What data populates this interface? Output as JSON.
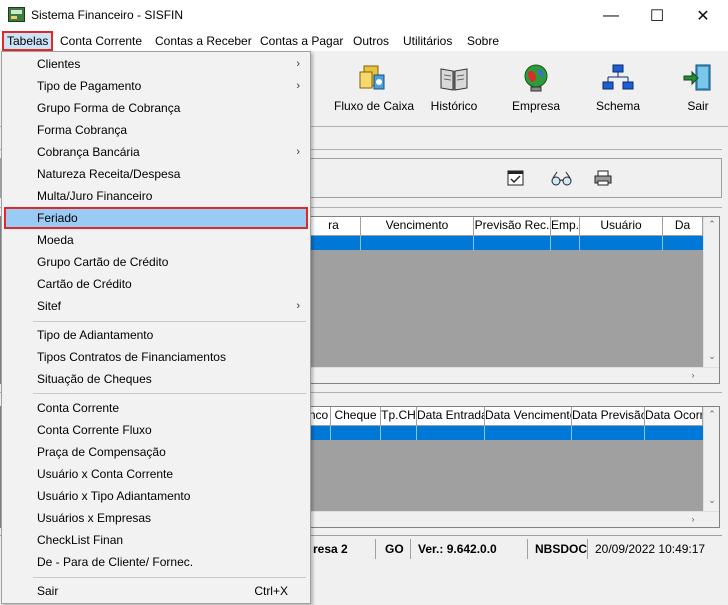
{
  "window": {
    "title": "Sistema Financeiro - SISFIN",
    "min": "—",
    "max": "☐",
    "close": "✕"
  },
  "menubar": [
    {
      "label": "Tabelas"
    },
    {
      "label": "Conta Corrente"
    },
    {
      "label": "Contas a Receber"
    },
    {
      "label": "Contas a Pagar"
    },
    {
      "label": "Outros"
    },
    {
      "label": "Utilitários"
    },
    {
      "label": "Sobre"
    }
  ],
  "toolbar": [
    {
      "label": "Fluxo de Caixa",
      "icon": "cash-flow-icon"
    },
    {
      "label": "Histórico",
      "icon": "book-icon"
    },
    {
      "label": "Empresa",
      "icon": "globe-icon"
    },
    {
      "label": "Schema",
      "icon": "network-icon"
    },
    {
      "label": "Sair",
      "icon": "exit-icon"
    }
  ],
  "grid1": {
    "columns": [
      "ra",
      "Vencimento",
      "Previsão Rec.",
      "Emp.",
      "Usuário",
      "Da"
    ]
  },
  "grid2": {
    "columns": [
      "nco",
      "Cheque",
      "Tp.CH",
      "Data Entrada",
      "Data Vencimento",
      "Data Previsão",
      "Data Ocorrê"
    ]
  },
  "statusbar": {
    "empresa": "resa 2",
    "uf": "GO",
    "version": "Ver.: 9.642.0.0",
    "schema": "NBSDOC",
    "datetime": "20/09/2022 10:49:17"
  },
  "dropdown": {
    "items": [
      {
        "label": "Clientes",
        "submenu": "›"
      },
      {
        "label": "Tipo de Pagamento",
        "submenu": "›"
      },
      {
        "label": "Grupo Forma de Cobrança"
      },
      {
        "label": "Forma Cobrança"
      },
      {
        "label": "Cobrança Bancária",
        "submenu": "›"
      },
      {
        "label": "Natureza Receita/Despesa"
      },
      {
        "label": "Multa/Juro Financeiro"
      },
      {
        "label": "Feriado"
      },
      {
        "label": "Moeda"
      },
      {
        "label": "Grupo Cartão de Crédito"
      },
      {
        "label": "Cartão de Crédito"
      },
      {
        "label": "Sitef",
        "submenu": "›"
      },
      {
        "label": "Tipo de Adiantamento"
      },
      {
        "label": "Tipos Contratos de Financiamentos"
      },
      {
        "label": "Situação de Cheques"
      },
      {
        "label": "Conta Corrente"
      },
      {
        "label": "Conta Corrente Fluxo"
      },
      {
        "label": "Praça de Compensação"
      },
      {
        "label": "Usuário x Conta Corrente"
      },
      {
        "label": "Usuário x Tipo Adiantamento"
      },
      {
        "label": "Usuários x Empresas"
      },
      {
        "label": "CheckList Finan"
      },
      {
        "label": "De - Para de Cliente/ Fornec."
      },
      {
        "label": "Sair",
        "shortcut": "Ctrl+X"
      }
    ]
  }
}
